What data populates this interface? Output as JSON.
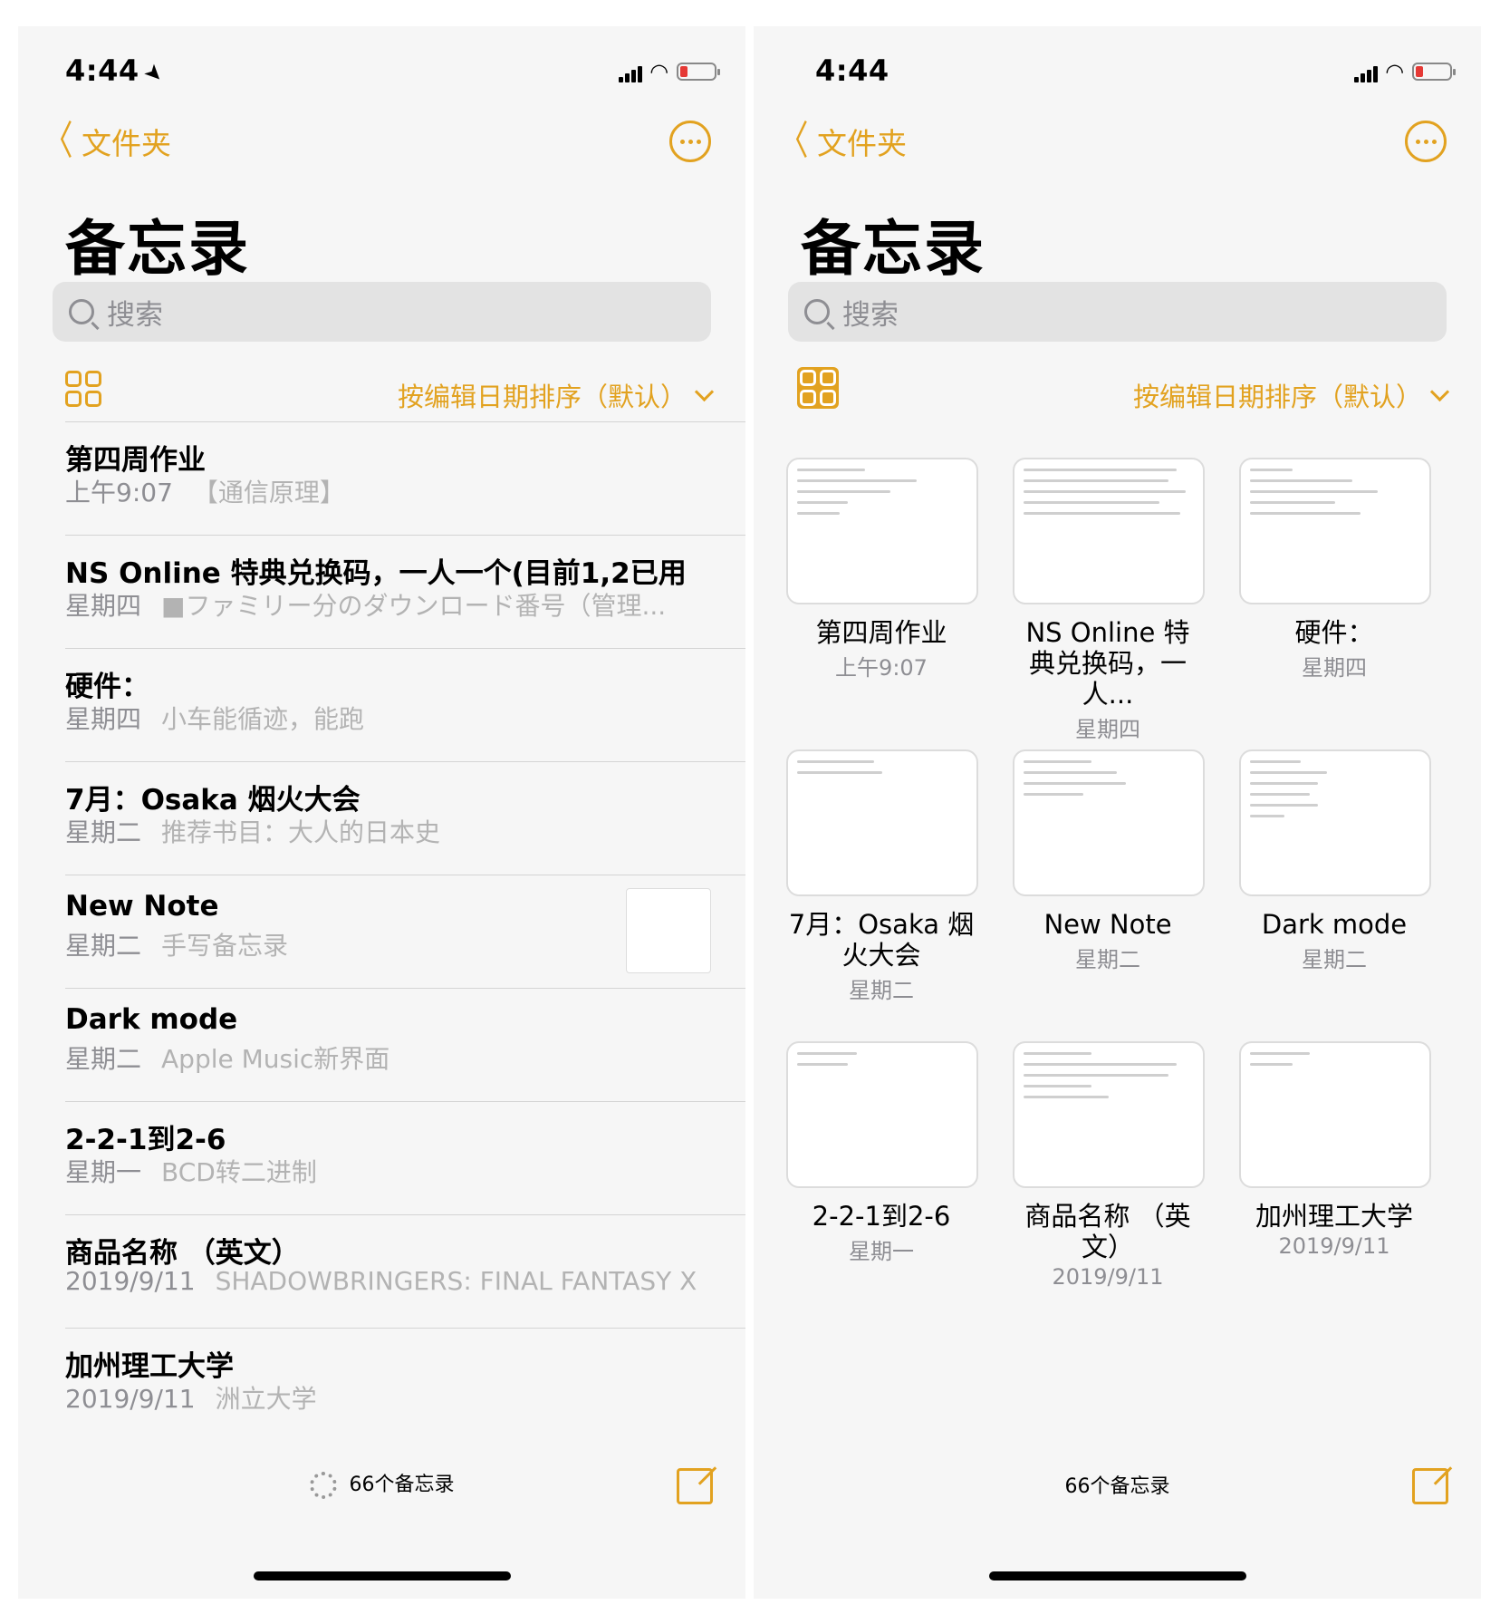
{
  "status": {
    "left_time": "4:44",
    "right_time": "4:44"
  },
  "nav": {
    "back_label": "文件夹",
    "title": "备忘录"
  },
  "search": {
    "placeholder": "搜索"
  },
  "sort": {
    "label": "按编辑日期排序（默认）"
  },
  "accent_color": "#e2a220",
  "list_notes": [
    {
      "title": "第四周作业",
      "date": "上午9:07",
      "preview": "【通信原理】"
    },
    {
      "title": "NS Online 特典兑换码，一人一个(目前1,2已用",
      "date": "星期四",
      "preview": "■ファミリー分のダウンロード番号（管理..."
    },
    {
      "title": "硬件：",
      "date": "星期四",
      "preview": "小车能循迹，能跑"
    },
    {
      "title": "7月：Osaka 烟火大会",
      "date": "星期二",
      "preview": "推荐书目：大人的日本史"
    },
    {
      "title": "New Note",
      "date": "星期二",
      "preview": "手写备忘录"
    },
    {
      "title": "Dark mode",
      "date": "星期二",
      "preview": "Apple Music新界面"
    },
    {
      "title": "2-2-1到2-6",
      "date": "星期一",
      "preview": "BCD转二进制"
    },
    {
      "title": "商品名称 （英文）",
      "date": "2019/9/11",
      "preview": "SHADOWBRINGERS: FINAL FANTASY XI..."
    },
    {
      "title": "加州理工大学",
      "date": "2019/9/11",
      "preview": "洲立大学"
    }
  ],
  "grid_notes": [
    {
      "title": "第四周作业",
      "date": "上午9:07"
    },
    {
      "title": "NS Online 特典兑换码，一人...",
      "date": "星期四"
    },
    {
      "title": "硬件：",
      "date": "星期四"
    },
    {
      "title": "7月：Osaka 烟火大会",
      "date": "星期二"
    },
    {
      "title": "New Note",
      "date": "星期二"
    },
    {
      "title": "Dark mode",
      "date": "星期二"
    },
    {
      "title": "2-2-1到2-6",
      "date": "星期一"
    },
    {
      "title": "商品名称 （英文）",
      "date": "2019/9/11"
    },
    {
      "title": "加州理工大学",
      "date": "2019/9/11"
    }
  ],
  "footer": {
    "count_label": "66个备忘录"
  }
}
